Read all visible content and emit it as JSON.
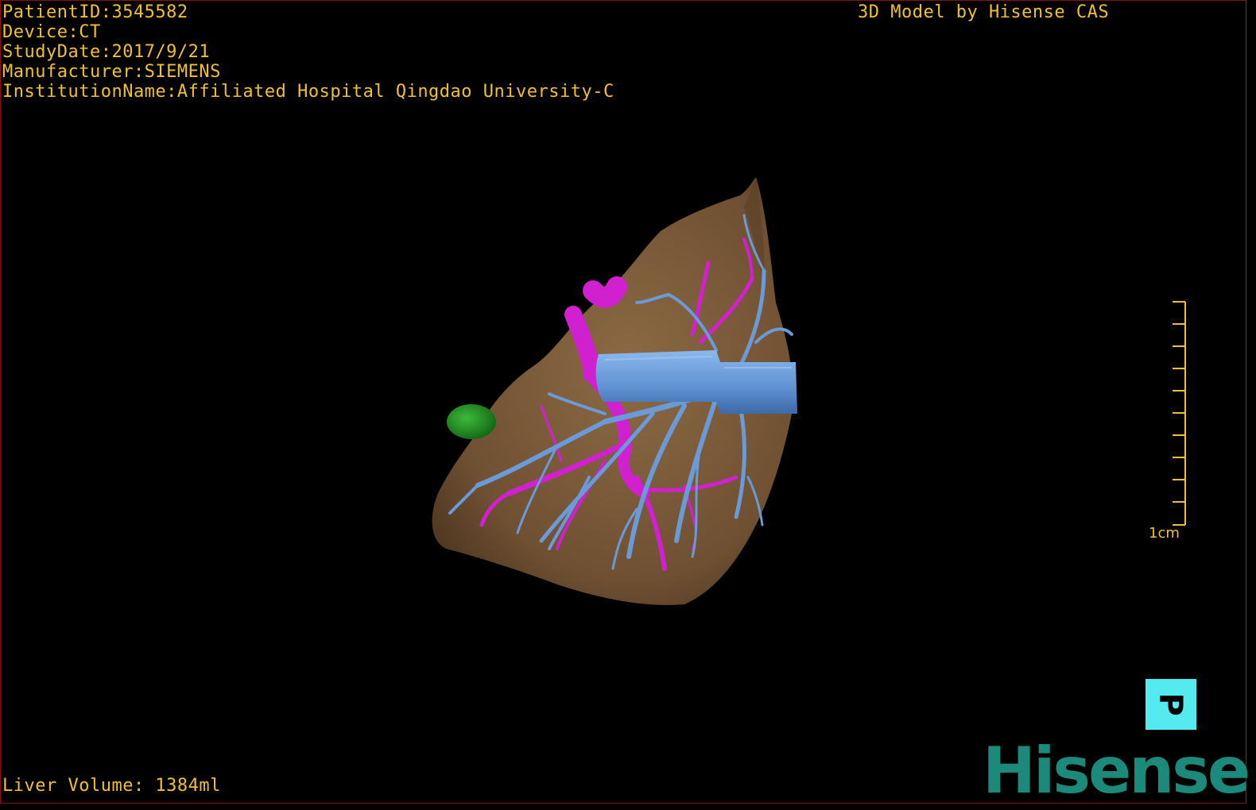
{
  "overlay": {
    "patient_id": "PatientID:3545582",
    "device": "Device:CT",
    "study_date": "StudyDate:2017/9/21",
    "manufacturer": "Manufacturer:SIEMENS",
    "institution": "InstitutionName:Affiliated Hospital Qingdao University-C",
    "title": "3D Model by Hisense CAS",
    "liver_volume": "Liver Volume: 1384ml"
  },
  "scale_bar": {
    "label": "1cm"
  },
  "orientation_button": {
    "label": "P"
  },
  "brand": {
    "logo_text": "Hisense"
  },
  "colors": {
    "overlay_text": "#f0c030",
    "liver": "#7a5a38",
    "portal_vein": "#6a9ad8",
    "hepatic_vein": "#d020d0",
    "lesion": "#1f8a1f",
    "orientation_button": "#55eaf0",
    "brand": "#1b8a7a"
  }
}
